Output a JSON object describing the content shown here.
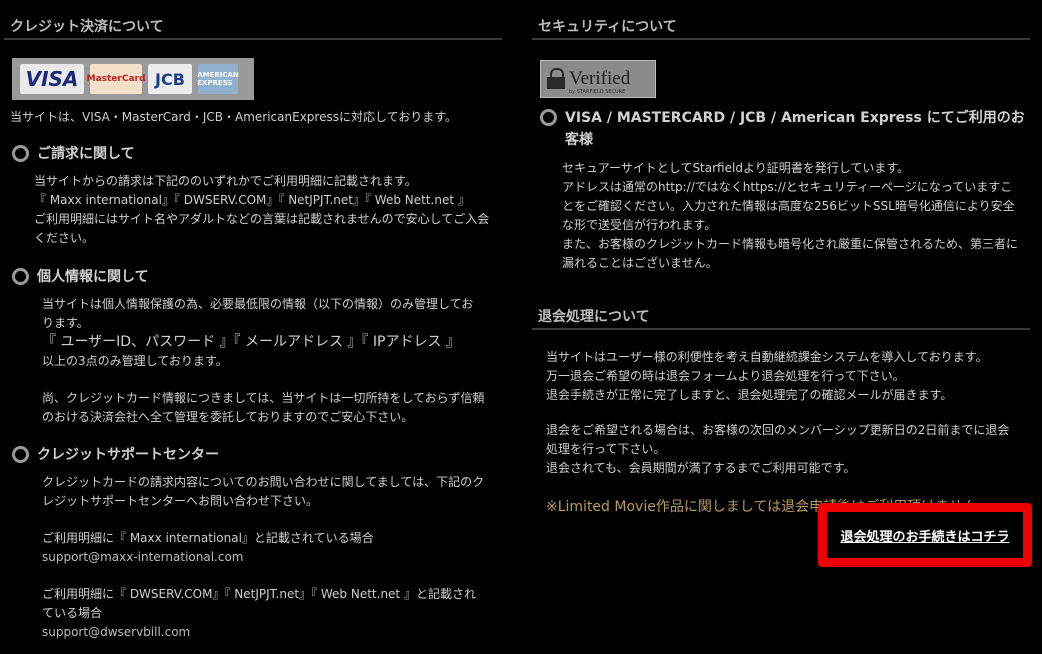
{
  "left": {
    "credit_heading": "クレジット決済について",
    "card_logos": {
      "visa": "VISA",
      "mastercard": "MasterCard",
      "jcb": "JCB",
      "amex": "AMERICAN EXPRESS"
    },
    "supported_text": "当サイトは、VISA・MasterCard・JCB・AmericanExpressに対応しております。",
    "billing": {
      "title": "ご請求に関して",
      "line1": "当サイトからの請求は下記ののいずれかでご利用明細に記載されます。",
      "line2": "『 Maxx international』『 DWSERV.COM』『 NetJPJT.net』『 Web Nett.net 』",
      "line3": "ご利用明細にはサイト名やアダルトなどの言葉は記載されませんので安心してご入会",
      "line4": "ください。"
    },
    "privacy": {
      "title": "個人情報に関して",
      "line1": "当サイトは個人情報保護の為、必要最低限の情報（以下の情報）のみ管理してお",
      "line2": "ります。",
      "line3": "『 ユーザーID、パスワード 』『 メールアドレス 』『 IPアドレス 』",
      "line4": "以上の3点のみ管理しております。",
      "line5": "尚、クレジットカード情報につきましては、当サイトは一切所持をしておらず信頼",
      "line6": "のおける決済会社へ全て管理を委託しておりますのでご安心下さい。"
    },
    "support": {
      "title": "クレジットサポートセンター",
      "line1": "クレジットカードの請求内容についてのお問い合わせに関してましては、下記のク",
      "line2": "レジットサポートセンターへお問い合わせ下さい。",
      "case1": "ご利用明細に『 Maxx international』と記載されている場合",
      "email1": "support@maxx-international.com",
      "case2a": "ご利用明細に『 DWSERV.COM』『 NetJPJT.net』『 Web Nett.net 』と記載され",
      "case2b": "ている場合",
      "email2": "support@dwservbill.com"
    }
  },
  "right": {
    "security_heading": "セキュリティについて",
    "verified_badge": "Verified",
    "verified_sub": "by STARFIELD SECURE",
    "secure": {
      "title_line1": "VISA / MASTERCARD / JCB / American Express にてご利用のお",
      "title_line2": "客様",
      "line1": "セキュアーサイトとしてStarfieldより証明書を発行しています。",
      "line2": "アドレスは通常のhttp://ではなくhttps://とセキュリティーページになっていますこ",
      "line3": "とをご確認ください。入力された情報は高度な256ビットSSL暗号化通信により安全",
      "line4": "な形で送受信が行われます。",
      "line5": "また、お客様のクレジットカード情報も暗号化され厳重に保管されるため、第三者に",
      "line6": "漏れることはございません。"
    },
    "withdraw_heading": "退会処理について",
    "withdraw": {
      "line1": "当サイトはユーザー様の利便性を考え自動継続課金システムを導入しております。",
      "line2": "万一退会ご希望の時は退会フォームより退会処理を行って下さい。",
      "line3": "退会手続きが正常に完了しますと、退会処理完了の確認メールが届きます。",
      "line4": "退会をご希望される場合は、お客様の次回のメンバーシップ更新日の2日前までに退会",
      "line5": "処理を行って下さい。",
      "line6": "退会されても、会員期間が満了するまでご利用可能です。",
      "note": "※Limited Movie作品に関しましては退会申請後はご利用頂けません",
      "link_label": "退会処理のお手続きはコチラ"
    }
  }
}
